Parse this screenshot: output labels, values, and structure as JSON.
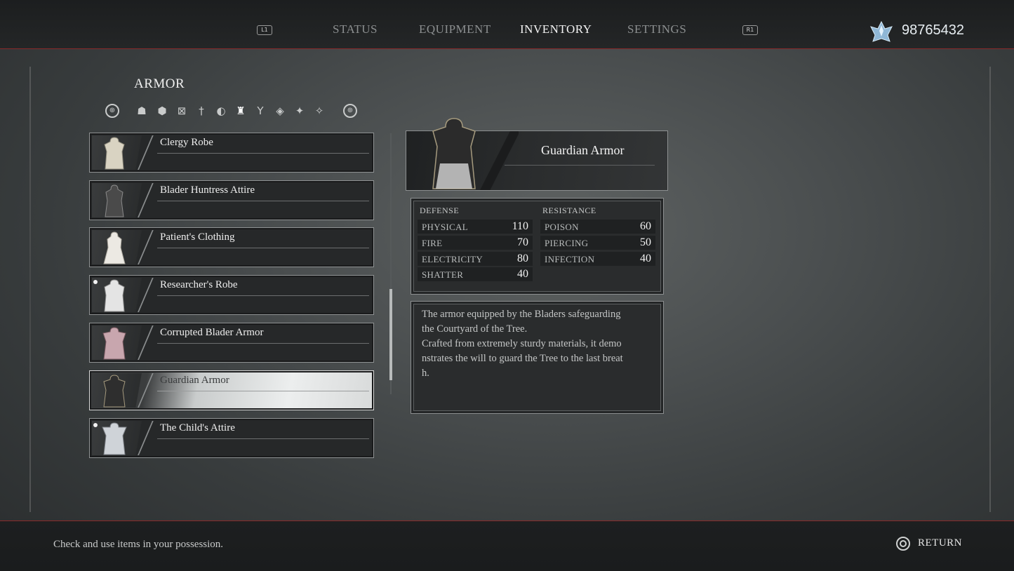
{
  "header": {
    "left_button": "L1",
    "right_button": "R1",
    "tabs": [
      {
        "label": "STATUS",
        "active": false
      },
      {
        "label": "EQUIPMENT",
        "active": false
      },
      {
        "label": "INVENTORY",
        "active": true
      },
      {
        "label": "SETTINGS",
        "active": false
      }
    ],
    "currency_icon": "crystal-icon",
    "currency": "98765432"
  },
  "armor": {
    "title": "ARMOR",
    "filters": [
      "prev-l-stick-icon",
      "headgear-icon",
      "shield-icon",
      "crossed-box-icon",
      "sword-icon",
      "helmet-icon",
      "attire-icon",
      "feather-icon",
      "crystal-icon",
      "sparkle-icon",
      "star-icon",
      "next-r-stick-icon"
    ],
    "active_filter": 6,
    "items": [
      {
        "name": "Clergy Robe",
        "new": false,
        "selected": false
      },
      {
        "name": "Blader Huntress Attire",
        "new": false,
        "selected": false
      },
      {
        "name": "Patient's Clothing",
        "new": false,
        "selected": false
      },
      {
        "name": "Researcher's Robe",
        "new": true,
        "selected": false
      },
      {
        "name": "Corrupted Blader Armor",
        "new": false,
        "selected": false
      },
      {
        "name": "Guardian Armor",
        "new": false,
        "selected": true
      },
      {
        "name": "The Child's Attire",
        "new": true,
        "selected": false
      }
    ]
  },
  "detail": {
    "name": "Guardian Armor",
    "defense": {
      "label": "DEFENSE",
      "rows": [
        {
          "label": "PHYSICAL",
          "value": "110"
        },
        {
          "label": "FIRE",
          "value": "70"
        },
        {
          "label": "ELECTRICITY",
          "value": "80"
        },
        {
          "label": "SHATTER",
          "value": "40"
        }
      ]
    },
    "resistance": {
      "label": "RESISTANCE",
      "rows": [
        {
          "label": "POISON",
          "value": "60"
        },
        {
          "label": "PIERCING",
          "value": "50"
        },
        {
          "label": "INFECTION",
          "value": "40"
        }
      ]
    },
    "description": "The armor equipped by the Bladers safeguarding\nthe Courtyard of the Tree.\nCrafted from extremely sturdy materials, it demo\nnstrates the will to guard the Tree to the last breat\nh."
  },
  "footer": {
    "hint": "Check and use items in your possession.",
    "return_label": "RETURN"
  },
  "colors": {
    "accent_line": "#8a2a2a",
    "selected_item": "#eceeee"
  }
}
